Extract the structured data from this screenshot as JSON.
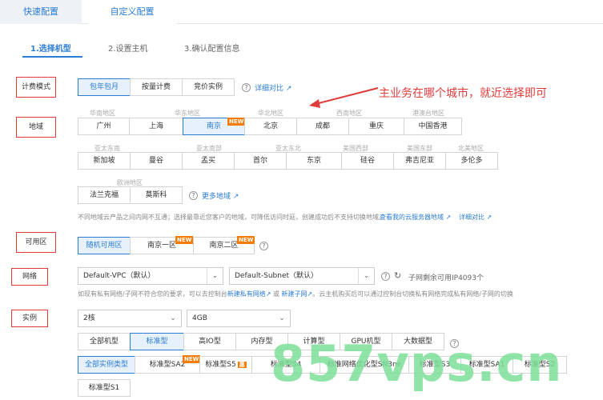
{
  "top_tabs": {
    "quick": "快速配置",
    "custom": "自定义配置"
  },
  "steps": [
    "1.选择机型",
    "2.设置主机",
    "3.确认配置信息"
  ],
  "labels": {
    "billing": "计费模式",
    "region": "地域",
    "zone": "可用区",
    "network": "网络",
    "instance": "实例"
  },
  "billing": {
    "options": [
      "包年包月",
      "按量计费",
      "竞价实例"
    ],
    "selected": "包年包月",
    "compare_link": "详细对比"
  },
  "annotation": "主业务在哪个城市，就近选择即可",
  "regions": {
    "groups_row1": [
      "华南地区",
      "华东地区",
      "华北地区",
      "西南地区",
      "港澳台地区"
    ],
    "row1": [
      "广州",
      "上海",
      "南京",
      "北京",
      "成都",
      "重庆",
      "中国香港"
    ],
    "groups_row2": [
      "亚太东南",
      "亚太南部",
      "亚太东北",
      "美国西部",
      "美国东部",
      "北美地区"
    ],
    "row2": [
      "新加坡",
      "曼谷",
      "孟买",
      "首尔",
      "东京",
      "硅谷",
      "弗吉尼亚",
      "多伦多"
    ],
    "groups_row3": [
      "欧洲地区"
    ],
    "row3": [
      "法兰克福",
      "莫斯科"
    ],
    "more_link": "更多地域",
    "selected": "南京",
    "new_badge": "NEW",
    "note": "不同地域云产品之间内网不互通；选择最靠近您客户的地域，可降低访问时延，创建成功后不支持切换地域。",
    "note_link1": "查看我的云服务器地域",
    "note_link2": "详细对比"
  },
  "zone": {
    "options": [
      "随机可用区",
      "南京一区",
      "南京二区"
    ],
    "selected": "随机可用区",
    "new_badge": "NEW"
  },
  "network": {
    "vpc": "Default-VPC（默认）",
    "subnet": "Default-Subnet（默认）",
    "remaining": "子网剩余可用IP4093个",
    "note_prefix": "如现有私有网络/子网不符合您的要求，可以去控制台",
    "link_vpc": "新建私有网络",
    "or": "或",
    "link_subnet": "新建子网",
    "note_suffix": "。云主机购买后可以通过控制台切换私有网络完成私有网络/子网的切换"
  },
  "instance": {
    "cpu": "2核",
    "mem": "4GB",
    "types": [
      "全部机型",
      "标准型",
      "高IO型",
      "内存型",
      "计算型",
      "GPU机型",
      "大数据型"
    ],
    "type_selected": "标准型",
    "families": [
      "全部实例类型",
      "标准型SA2",
      "标准型S5",
      "标准型S4",
      "标准网络优化型SN3ne",
      "标准型S3",
      "标准型SA1",
      "标准型S2"
    ],
    "family_selected": "全部实例类型",
    "families_row2": [
      "标准型S1"
    ],
    "new_badge": "NEW",
    "hot_badge": "惠"
  },
  "watermark": "857vps.cn",
  "colors": {
    "accent": "#2b7cd3",
    "red": "#e03b3b",
    "badge": "#f57c00"
  }
}
